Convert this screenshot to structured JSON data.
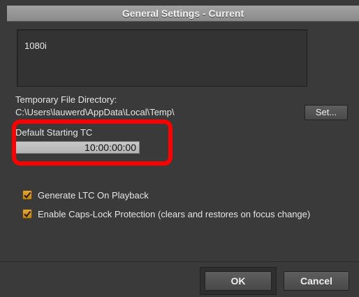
{
  "window": {
    "title": "General Settings - Current"
  },
  "format_box": {
    "value": "1080i"
  },
  "temp_dir": {
    "label": "Temporary File Directory:",
    "path": "C:\\Users\\lauwerd\\AppData\\Local\\Temp\\",
    "set_button": "Set..."
  },
  "timecode": {
    "label": "Default Starting TC",
    "value": "10:00:00:00",
    "highlight_color": "#ff0000"
  },
  "options": [
    {
      "label": "Generate LTC On Playback",
      "checked": true
    },
    {
      "label": "Enable Caps-Lock Protection (clears and restores on focus change)",
      "checked": true
    }
  ],
  "footer": {
    "ok_label": "OK",
    "cancel_label": "Cancel"
  },
  "colors": {
    "panel": "#3a3a3a",
    "checkbox_fill": "#d89a2a"
  }
}
